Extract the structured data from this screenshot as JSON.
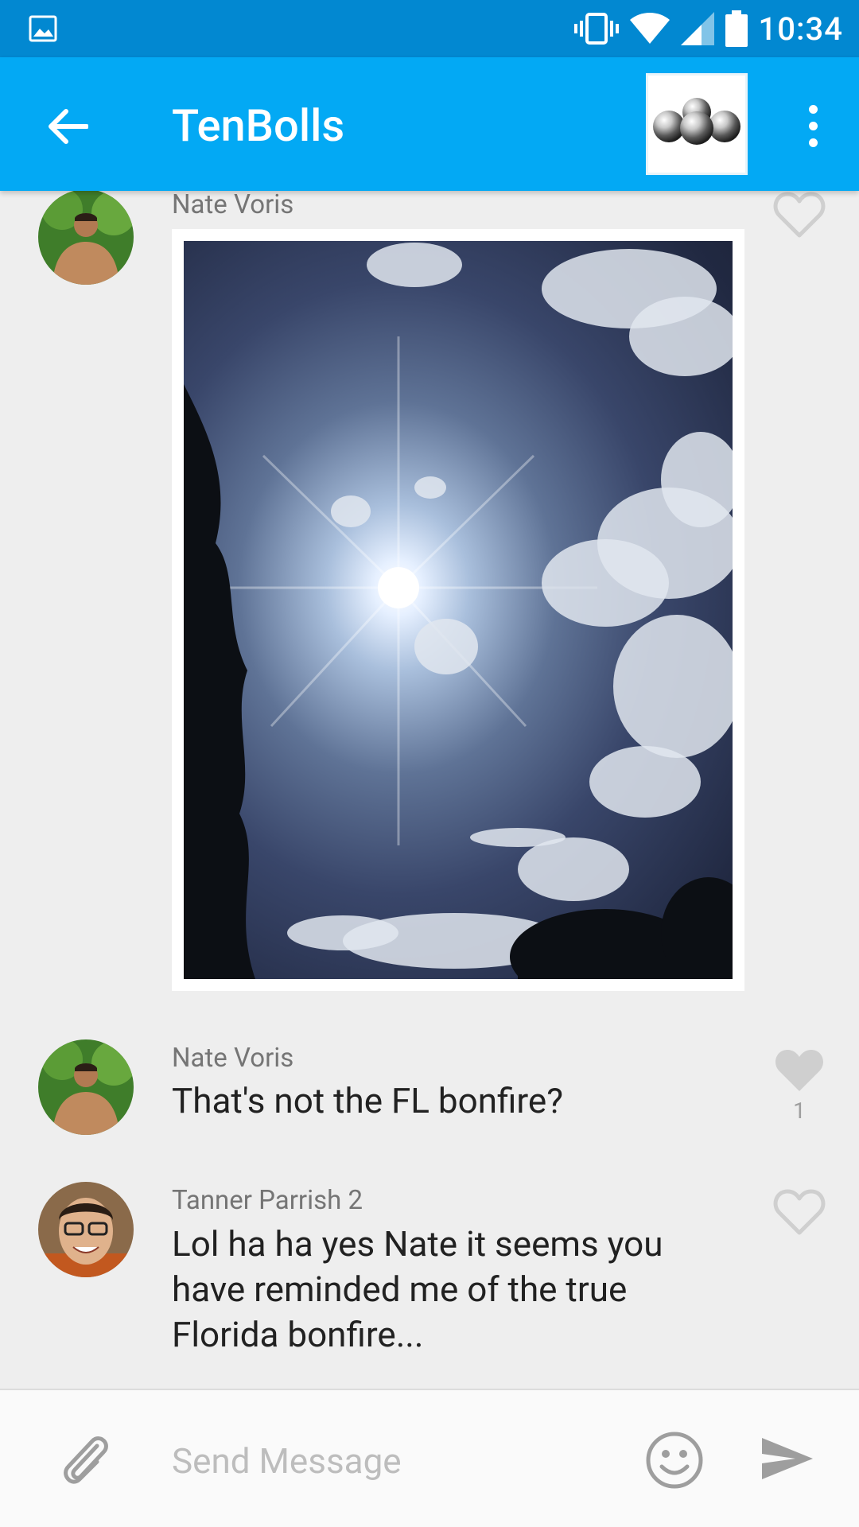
{
  "status_bar": {
    "time": "10:34",
    "icons": [
      "image-notification-icon",
      "vibrate-icon",
      "wifi-icon",
      "cell-signal-icon",
      "battery-icon"
    ]
  },
  "app_bar": {
    "title": "TenBolls",
    "group_image": "metal-balls-thumbnail"
  },
  "messages": [
    {
      "sender": "Nate Voris",
      "type": "image",
      "image_desc": "sun-through-clouds-photo",
      "liked": false,
      "likes": ""
    },
    {
      "sender": "Nate Voris",
      "type": "text",
      "text": "That's not the FL bonfire?",
      "liked": true,
      "likes": "1"
    },
    {
      "sender": "Tanner Parrish 2",
      "type": "text",
      "text": "Lol ha ha yes Nate it seems you have reminded me of the true Florida bonfire...",
      "liked": false,
      "likes": ""
    }
  ],
  "composer": {
    "placeholder": "Send Message"
  },
  "colors": {
    "status_bar": "#0288d1",
    "app_bar": "#03a9f4",
    "background": "#eeeeee"
  }
}
